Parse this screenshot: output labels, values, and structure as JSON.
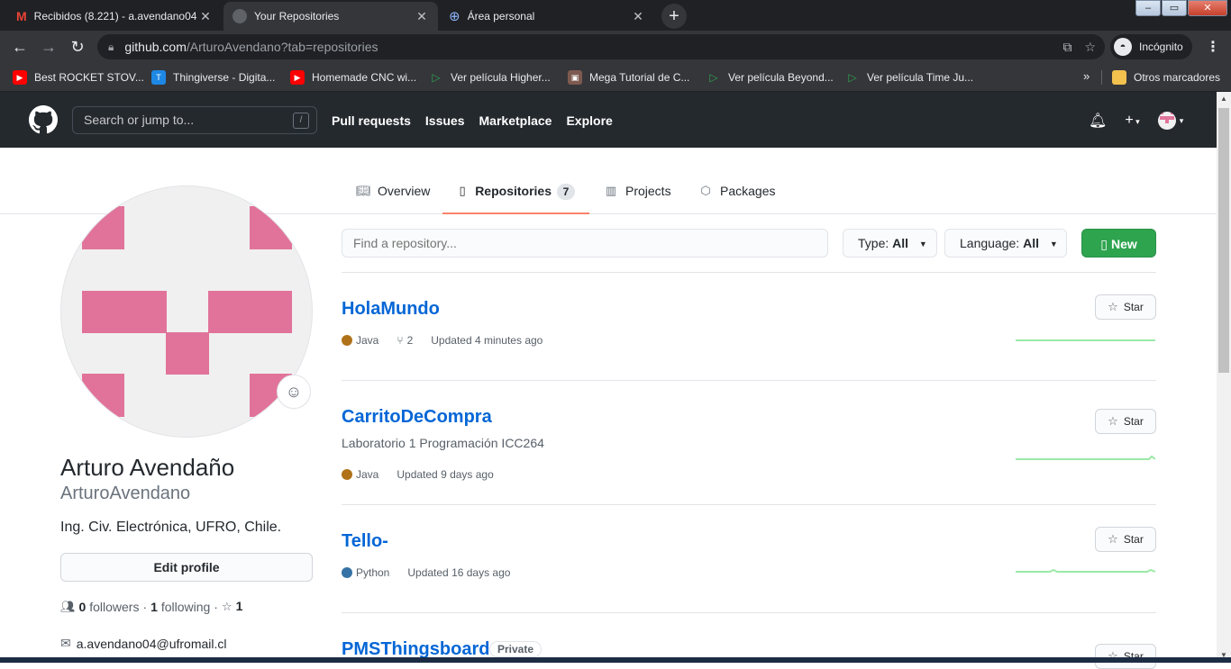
{
  "browser": {
    "tabs": [
      {
        "title": "Recibidos (8.221) - a.avendano04",
        "icon": "gmail-icon",
        "active": false
      },
      {
        "title": "Your Repositories",
        "icon": "github-icon",
        "active": true
      },
      {
        "title": "Área personal",
        "icon": "moodle-icon",
        "active": false
      }
    ],
    "new_tab": "+",
    "url_host": "github.com",
    "url_path": "/ArturoAvendano?tab=repositories",
    "incognito_label": "Incógnito",
    "bookmarks": [
      {
        "label": "Best ROCKET STOV...",
        "icon": "youtube-icon"
      },
      {
        "label": "Thingiverse - Digita...",
        "icon": "thingiverse-icon"
      },
      {
        "label": "Homemade CNC wi...",
        "icon": "youtube-icon"
      },
      {
        "label": "Ver película Higher...",
        "icon": "play-icon"
      },
      {
        "label": "Mega Tutorial de C...",
        "icon": "image-icon"
      },
      {
        "label": "Ver película Beyond...",
        "icon": "play-icon"
      },
      {
        "label": "Ver película Time Ju...",
        "icon": "play-icon"
      }
    ],
    "bookmarks_more": "»",
    "other_bookmarks": "Otros marcadores"
  },
  "github": {
    "search_placeholder": "Search or jump to...",
    "search_shortcut": "/",
    "nav": [
      "Pull requests",
      "Issues",
      "Marketplace",
      "Explore"
    ],
    "accent_color": "#f9826c",
    "link_color": "#0366d6"
  },
  "profile_tabs": [
    {
      "label": "Overview",
      "icon": "book-icon"
    },
    {
      "label": "Repositories",
      "icon": "repo-icon",
      "count": "7"
    },
    {
      "label": "Projects",
      "icon": "project-icon"
    },
    {
      "label": "Packages",
      "icon": "package-icon"
    }
  ],
  "profile": {
    "full_name": "Arturo Avendaño",
    "username": "ArturoAvendano",
    "bio": "Ing. Civ. Electrónica, UFRO, Chile.",
    "edit_label": "Edit profile",
    "followers_count": "0",
    "followers_label": "followers",
    "following_count": "1",
    "following_label": "following",
    "stars_count": "1",
    "email": "a.avendano04@ufromail.cl",
    "avatar_color": "#e1739a"
  },
  "filters": {
    "find_placeholder": "Find a repository...",
    "type_label": "Type:",
    "type_value": "All",
    "language_label": "Language:",
    "language_value": "All",
    "new_label": "New"
  },
  "repos": [
    {
      "name": "HolaMundo",
      "description": "",
      "language": "Java",
      "lang_color": "#b07219",
      "forks": "2",
      "updated": "Updated 4 minutes ago",
      "star_label": "Star"
    },
    {
      "name": "CarritoDeCompra",
      "description": "Laboratorio 1 Programación ICC264",
      "language": "Java",
      "lang_color": "#b07219",
      "updated": "Updated 9 days ago",
      "star_label": "Star"
    },
    {
      "name": "Tello-",
      "description": "",
      "language": "Python",
      "lang_color": "#3572a5",
      "updated": "Updated 16 days ago",
      "star_label": "Star"
    },
    {
      "name": "PMSThingsboard",
      "badge": "Private",
      "star_label": "Star"
    }
  ]
}
